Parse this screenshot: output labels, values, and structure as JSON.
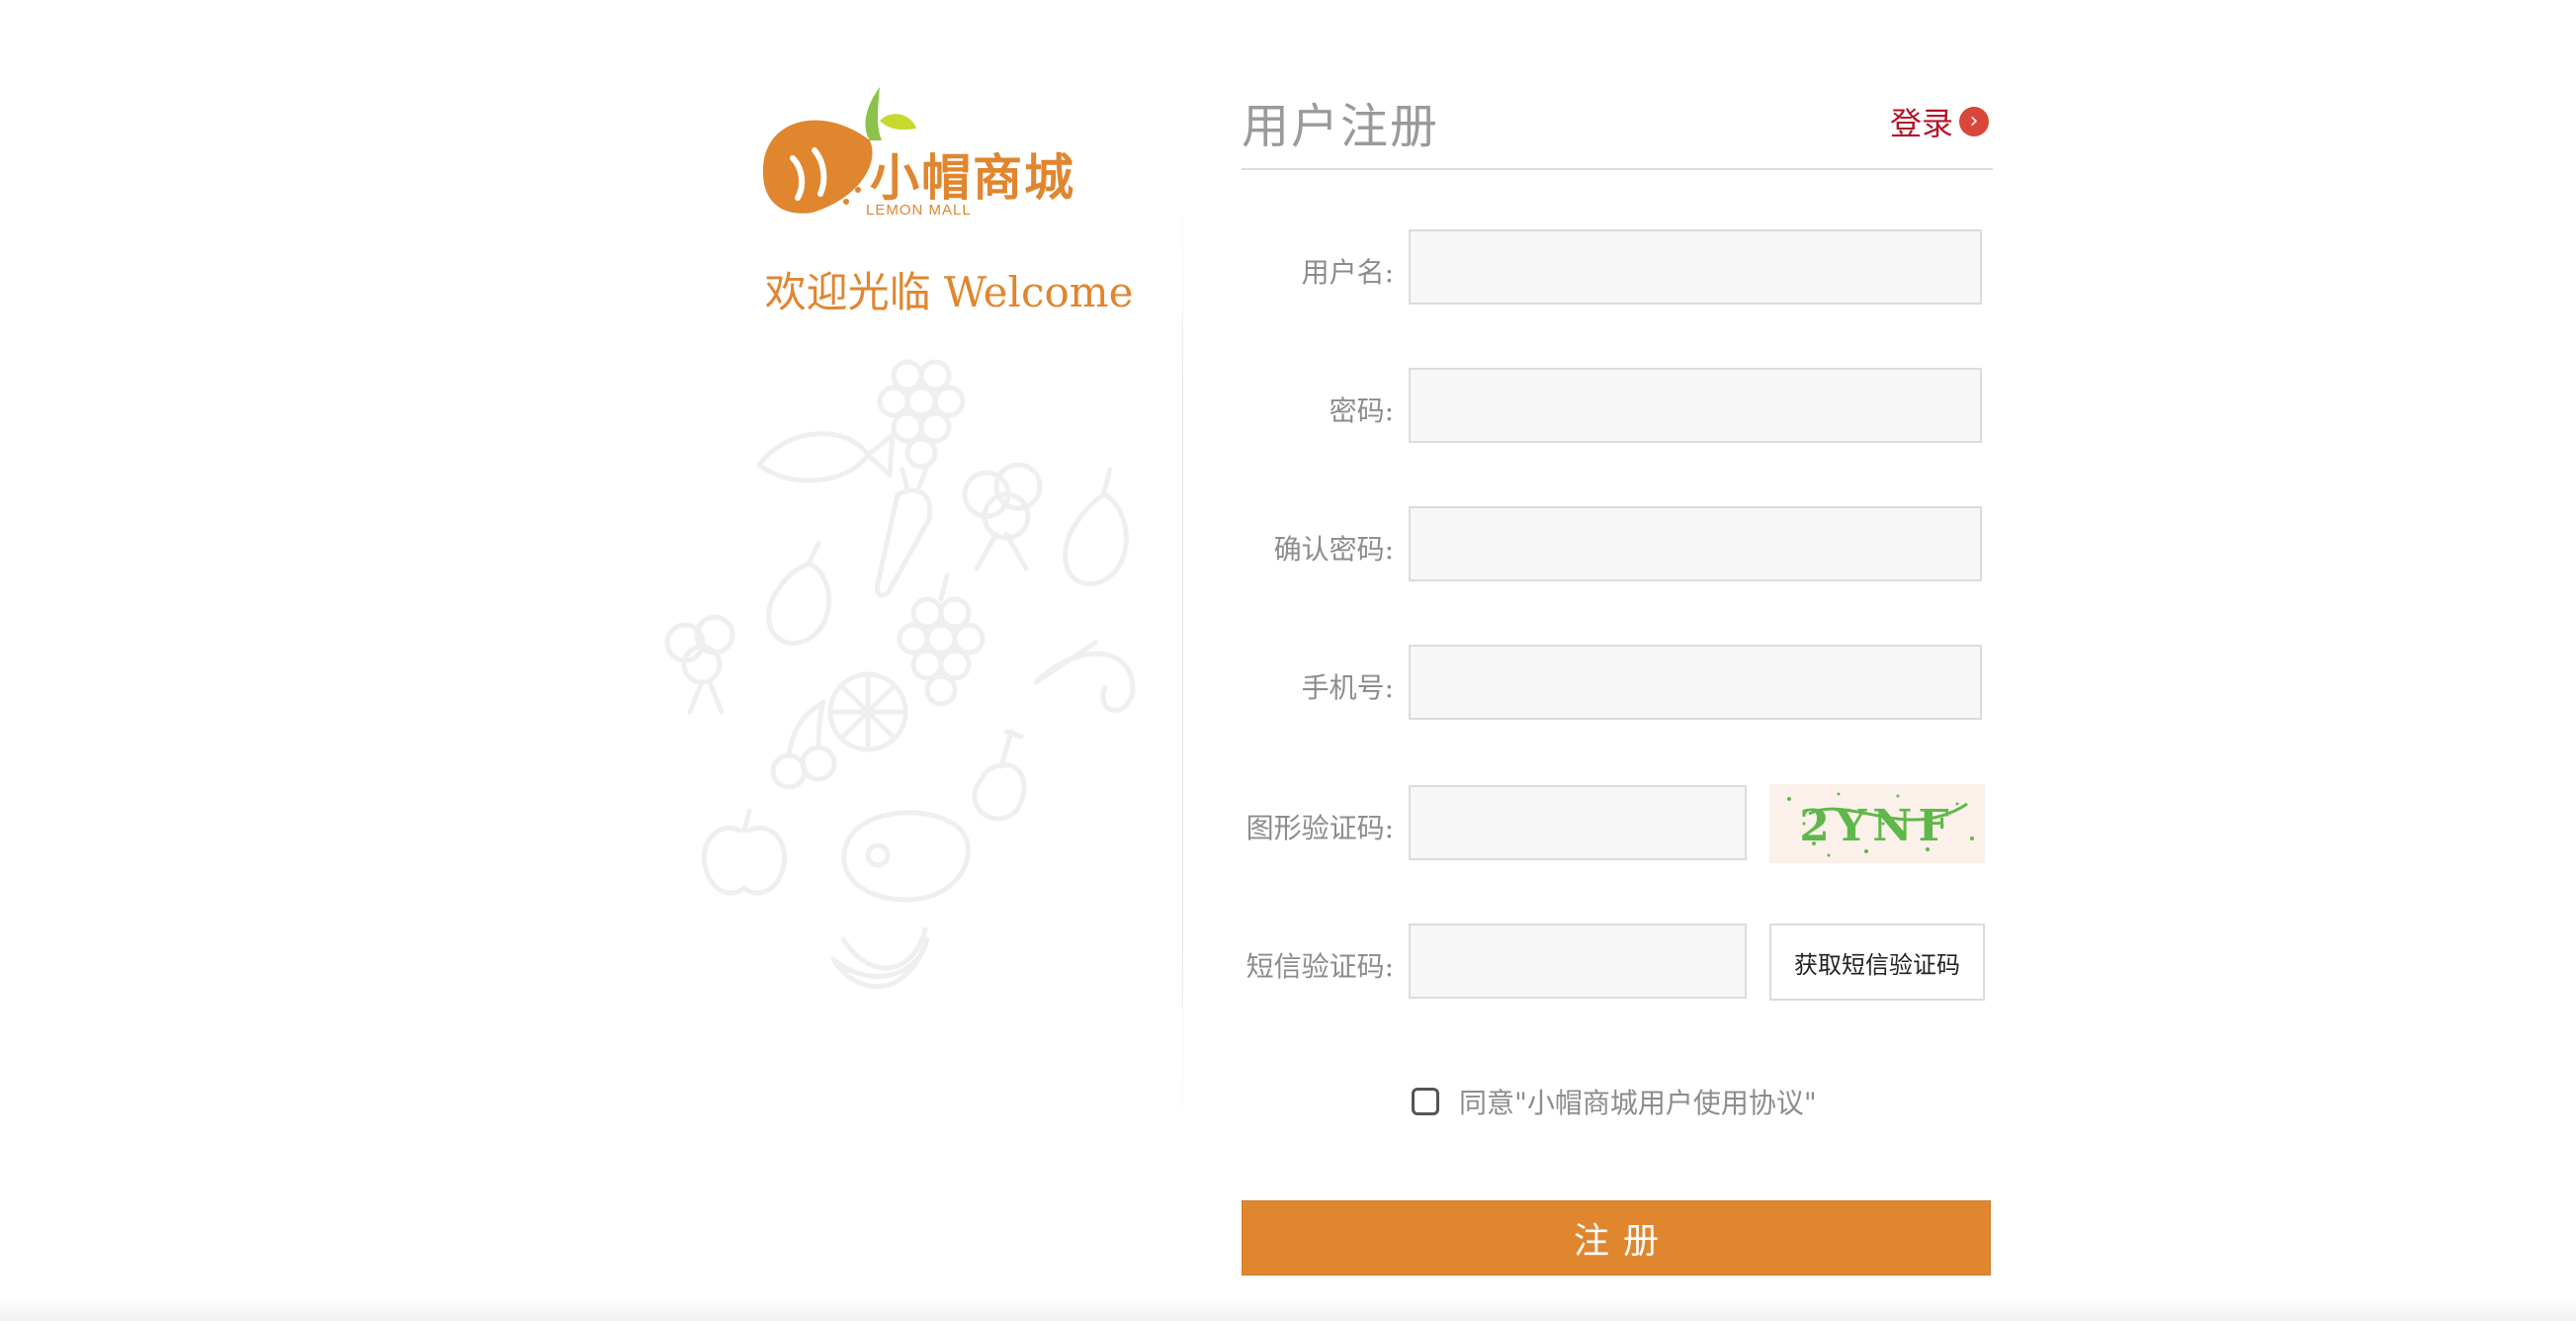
{
  "brand": {
    "name": "小帽商城",
    "subtitle": "LEMON MALL",
    "welcome": "欢迎光临 Welcome",
    "accent_color": "#e0862f"
  },
  "header": {
    "title": "用户注册",
    "login_label": "登录",
    "login_icon": "chevron-right-circle-icon"
  },
  "form": {
    "username": {
      "label": "用户名:",
      "value": "",
      "placeholder": ""
    },
    "password": {
      "label": "密码:",
      "value": "",
      "placeholder": ""
    },
    "confirm_password": {
      "label": "确认密码:",
      "value": "",
      "placeholder": ""
    },
    "phone": {
      "label": "手机号:",
      "value": "",
      "placeholder": ""
    },
    "image_captcha": {
      "label": "图形验证码:",
      "value": "",
      "placeholder": "",
      "captcha_text": "2YNF"
    },
    "sms_code": {
      "label": "短信验证码:",
      "value": "",
      "placeholder": "",
      "button_label": "获取短信验证码"
    },
    "agreement": {
      "checked": false,
      "text": "同意\"小帽商城用户使用协议\""
    },
    "submit_label": "注册"
  },
  "colors": {
    "primary_button": "#e0862f",
    "login_link": "#b3152a",
    "captcha_text": "#5fb84a"
  }
}
